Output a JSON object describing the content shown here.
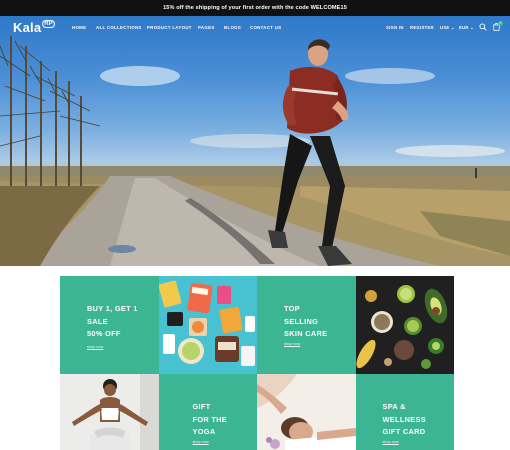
{
  "announcement": "15% off the shipping of your first order with the code WELCOME15",
  "brand": {
    "name": "Kala",
    "badge": "RP"
  },
  "nav": {
    "items": [
      "HOME",
      "ALL COLLECTIONS",
      "PRODUCT LAYOUT",
      "PAGES",
      "BLOGS",
      "CONTACT US"
    ],
    "sign_in": "SIGN IN",
    "register": "REGISTER",
    "language": "USE",
    "currency": "EUR"
  },
  "icons": {
    "search": "search-icon",
    "cart": "cart-icon",
    "cart_count": "0"
  },
  "promos": [
    {
      "lines": [
        "BUY 1, GET 1",
        "SALE",
        "50% OFF"
      ],
      "link": "shop now"
    },
    {
      "lines": [
        "TOP",
        "SELLING",
        "SKIN CARE"
      ],
      "link": "shop now"
    },
    {
      "lines": [
        "GIFT",
        "FOR THE",
        "YOGA"
      ],
      "link": "shop now"
    },
    {
      "lines": [
        "SPA &",
        "WELLNESS",
        "GIFT CARD"
      ],
      "link": "shop now"
    }
  ],
  "colors": {
    "accent_green": "#3cb595",
    "announcement_bg": "#111111"
  }
}
